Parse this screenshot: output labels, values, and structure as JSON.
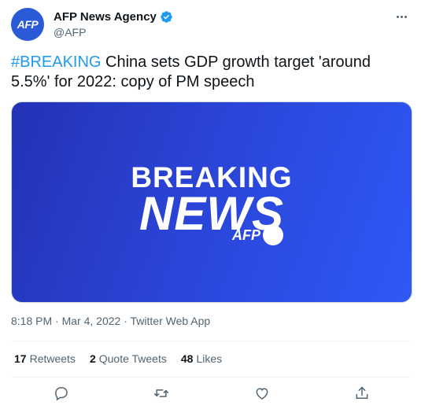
{
  "account": {
    "avatar_text": "AFP",
    "display_name": "AFP News Agency",
    "handle": "@AFP",
    "verified_icon": "verified-badge-icon",
    "avatar_color": "#2a5ad8"
  },
  "tweet": {
    "hashtag": "#BREAKING",
    "text": " China sets GDP growth target 'around 5.5%' for 2022: copy of PM speech"
  },
  "media": {
    "line1": "BREAKING",
    "line2": "NEWS",
    "brand": "AFP",
    "gradient_start": "#2432b5",
    "gradient_end": "#2f58f6"
  },
  "meta": {
    "time": "8:18 PM",
    "sep1": " · ",
    "date": "Mar 4, 2022",
    "sep2": " · ",
    "source": "Twitter Web App"
  },
  "stats": {
    "retweets_count": "17",
    "retweets_label": "Retweets",
    "quotes_count": "2",
    "quotes_label": "Quote Tweets",
    "likes_count": "48",
    "likes_label": "Likes"
  },
  "actions": [
    "reply-icon",
    "retweet-icon",
    "like-icon",
    "share-icon"
  ],
  "colors": {
    "link": "#1d9bf0",
    "secondary_text": "#536471",
    "primary_text": "#0f1419"
  }
}
